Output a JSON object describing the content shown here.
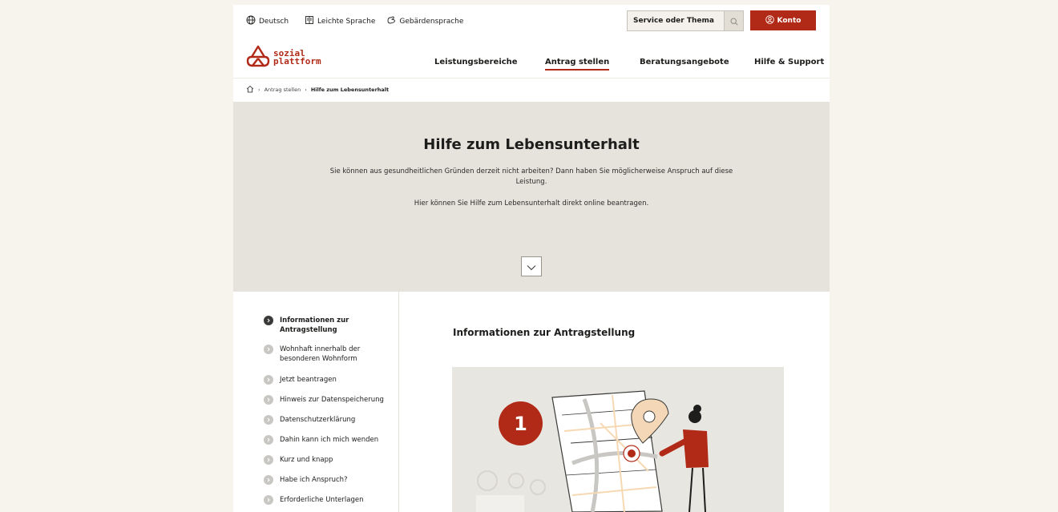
{
  "header": {
    "language": "Deutsch",
    "easy_language": "Leichte Sprache",
    "sign_language": "Gebärdensprache",
    "search_placeholder": "Service oder Thema",
    "account_label": "Konto"
  },
  "logo": {
    "line1": "sozial",
    "line2": "plattform"
  },
  "nav": {
    "items": [
      "Leistungsbereiche",
      "Antrag stellen",
      "Beratungsangebote",
      "Hilfe & Support"
    ],
    "active": "Antrag stellen"
  },
  "breadcrumb": {
    "items": [
      "Antrag stellen"
    ],
    "current": "Hilfe zum Lebensunterhalt"
  },
  "hero": {
    "title": "Hilfe zum Lebensunterhalt",
    "paragraph1": "Sie können aus gesundheitlichen Gründen derzeit nicht arbeiten? Dann haben Sie möglicherweise Anspruch auf diese Leistung.",
    "paragraph2": "Hier können Sie Hilfe zum Lebensunterhalt direkt online beantragen."
  },
  "sidebar": {
    "items": [
      "Informationen zur Antragstellung",
      "Wohnhaft innerhalb der besonderen Wohnform",
      "Jetzt beantragen",
      "Hinweis zur Datenspeicherung",
      "Datenschutzerklärung",
      "Dahin kann ich mich wenden",
      "Kurz und knapp",
      "Habe ich Anspruch?",
      "Erforderliche Unterlagen"
    ],
    "active_index": 0
  },
  "content": {
    "title": "Informationen zur Antragstellung",
    "step_number": "1"
  },
  "colors": {
    "accent": "#b12a17",
    "hero_bg": "#e6e3dc",
    "page_bg": "#f7f4ee"
  }
}
